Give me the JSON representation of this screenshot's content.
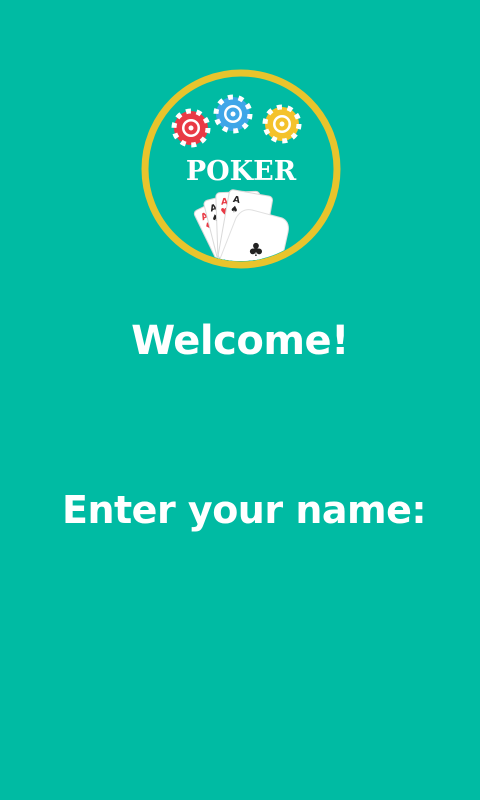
{
  "theme": {
    "background": "#00BBA3",
    "ring": "#E8C42C",
    "logo_fill": "#00BBA3",
    "text": "#FFFFFF",
    "chip_red": "#E93A45",
    "chip_blue": "#3FA6E8",
    "chip_yellow": "#F4C22B"
  },
  "logo": {
    "text": "POKER",
    "cards": [
      {
        "rank": "A",
        "suit": "♦",
        "color": "#E93A45"
      },
      {
        "rank": "A",
        "suit": "♠",
        "color": "#222222"
      },
      {
        "rank": "A",
        "suit": "♥",
        "color": "#E93A45"
      },
      {
        "rank": "A",
        "suit": "♠",
        "color": "#222222"
      },
      {
        "rank": "",
        "suit": "♣",
        "color": "#222222"
      }
    ]
  },
  "welcome": {
    "title": "Welcome!"
  },
  "name_form": {
    "prompt": "Enter your name:",
    "input_value": "",
    "input_placeholder": ""
  }
}
